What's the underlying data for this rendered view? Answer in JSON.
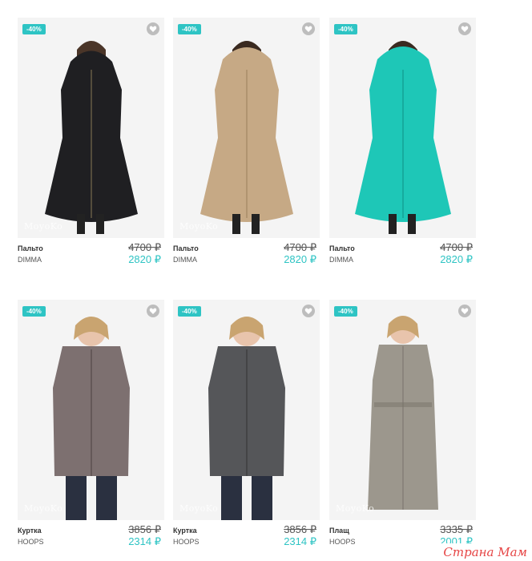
{
  "watermark_site": "Страна Мам",
  "photo_watermark": "MoyoKo",
  "badge_color": "#2ec4c4",
  "products": [
    {
      "badge": "-40%",
      "name": "Пальто",
      "brand": "DIMMA",
      "old_price": "4700 ₽",
      "new_price": "2820 ₽",
      "coat_color": "#1f1f22"
    },
    {
      "badge": "-40%",
      "name": "Пальто",
      "brand": "DIMMA",
      "old_price": "4700 ₽",
      "new_price": "2820 ₽",
      "coat_color": "#c6a985"
    },
    {
      "badge": "-40%",
      "name": "Пальто",
      "brand": "DIMMA",
      "old_price": "4700 ₽",
      "new_price": "2820 ₽",
      "coat_color": "#1ec7b7"
    },
    {
      "badge": "-40%",
      "name": "Куртка",
      "brand": "HOOPS",
      "old_price": "3856 ₽",
      "new_price": "2314 ₽",
      "coat_color": "#7d7070"
    },
    {
      "badge": "-40%",
      "name": "Куртка",
      "brand": "HOOPS",
      "old_price": "3856 ₽",
      "new_price": "2314 ₽",
      "coat_color": "#555659"
    },
    {
      "badge": "-40%",
      "name": "Плащ",
      "brand": "HOOPS",
      "old_price": "3335 ₽",
      "new_price": "2001 ₽",
      "coat_color": "#9c978d"
    }
  ]
}
